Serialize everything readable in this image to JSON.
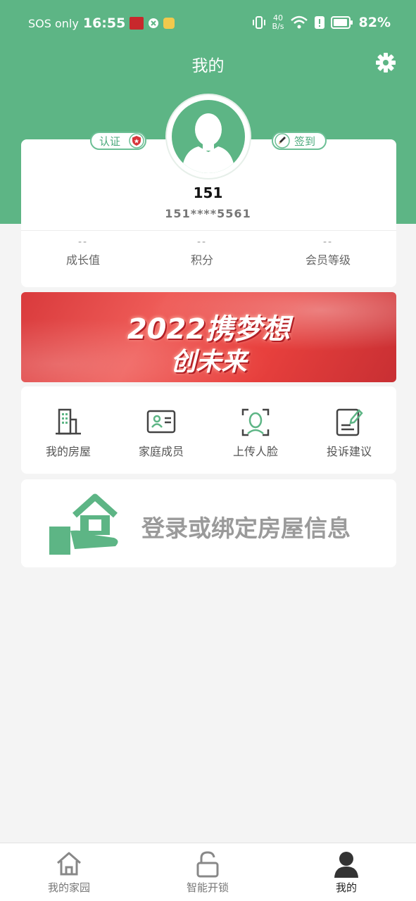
{
  "status_bar": {
    "carrier": "SOS only",
    "time": "16:55",
    "net_speed_value": "40",
    "net_speed_unit": "B/s",
    "battery": "82%"
  },
  "header": {
    "title": "我的",
    "background_color": "#5db585",
    "settings_icon": "gear-icon"
  },
  "profile": {
    "certify_label": "认证",
    "sign_in_label": "签到",
    "username": "151",
    "phone": "151****5561"
  },
  "stats": [
    {
      "value": "--",
      "label": "成长值"
    },
    {
      "value": "--",
      "label": "积分"
    },
    {
      "value": "--",
      "label": "会员等级"
    }
  ],
  "banner": {
    "line1": "2022携梦想",
    "line2": "创未来"
  },
  "quick_actions": [
    {
      "label": "我的房屋",
      "icon": "building-icon"
    },
    {
      "label": "家庭成员",
      "icon": "id-card-icon"
    },
    {
      "label": "上传人脸",
      "icon": "face-scan-icon"
    },
    {
      "label": "投诉建议",
      "icon": "feedback-icon"
    }
  ],
  "bind_card": {
    "text": "登录或绑定房屋信息",
    "icon": "house-in-hand-icon"
  },
  "tabs": [
    {
      "label": "我的家园",
      "icon": "home-icon"
    },
    {
      "label": "智能开锁",
      "icon": "unlock-icon"
    },
    {
      "label": "我的",
      "icon": "person-icon",
      "active": true
    }
  ],
  "colors": {
    "accent": "#5db585",
    "page_background": "#f4f4f4"
  }
}
